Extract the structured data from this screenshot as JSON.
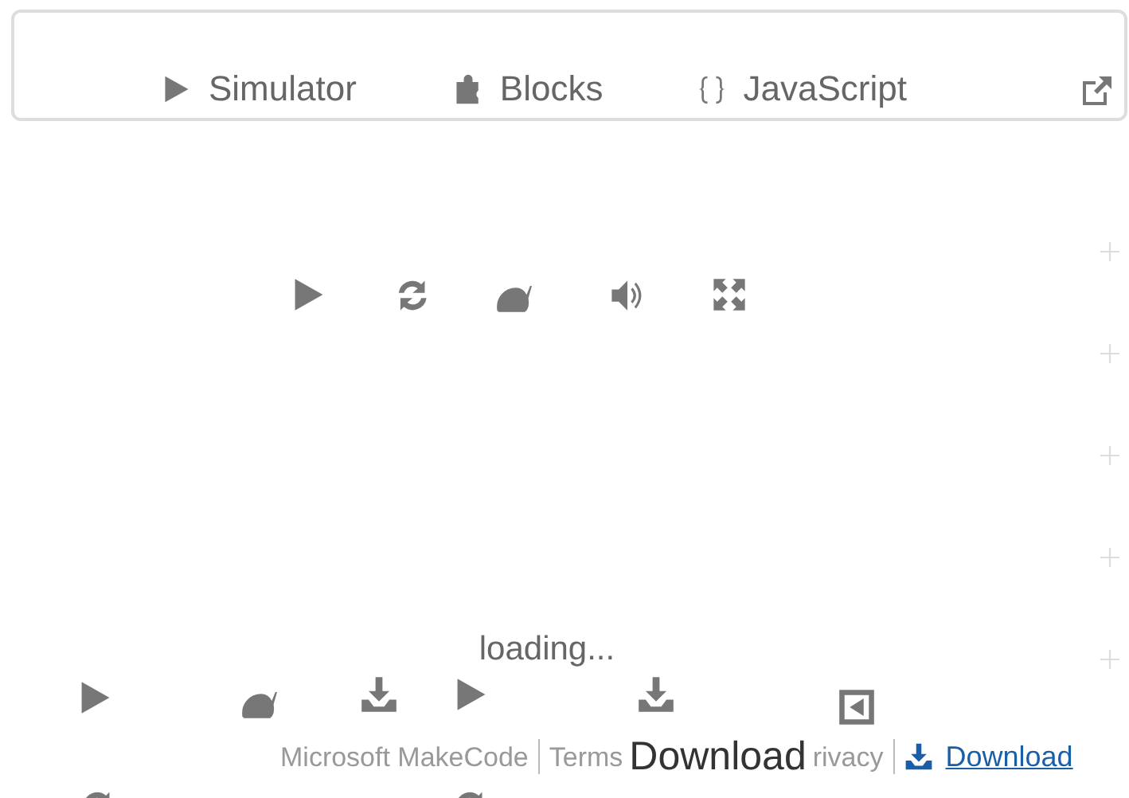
{
  "editor_tabs": [
    {
      "label": "Simulator",
      "kind": "play"
    },
    {
      "label": "Blocks",
      "kind": "puzzle"
    },
    {
      "label": "JavaScript",
      "kind": "braces"
    }
  ],
  "status": "loading...",
  "overlay_text": "Download",
  "footer": {
    "links": [
      "Microsoft MakeCode",
      "Terms",
      "rivacy"
    ],
    "download_button": "Download"
  }
}
